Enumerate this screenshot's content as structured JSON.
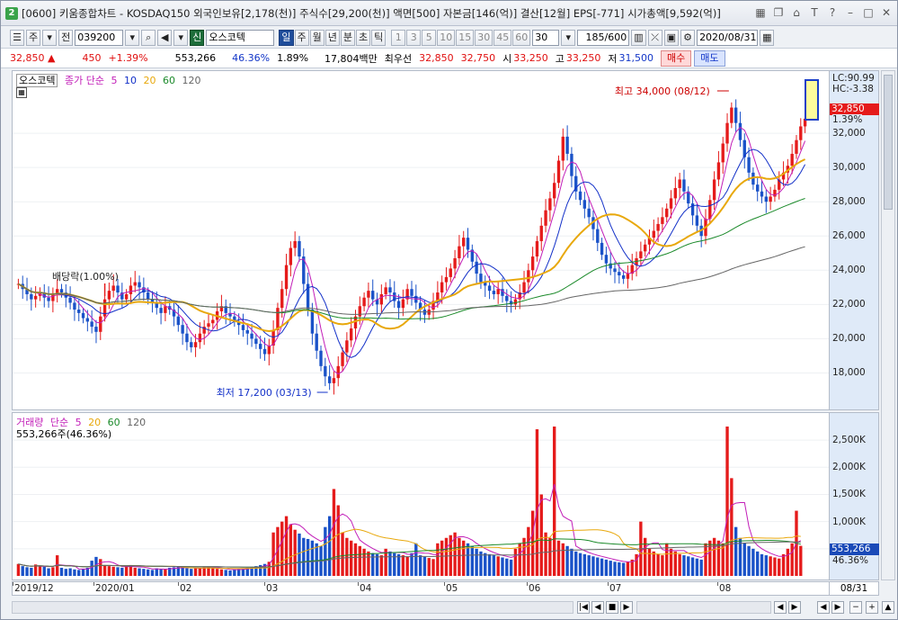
{
  "window": {
    "app_badge": "2",
    "title": "[0600] 키움종합차트 - KOSDAQ150 외국인보유[2,178(천)] 주식수[29,200(천)] 액면[500] 자본금[146(억)] 결산[12월] EPS[-771] 시가총액[9,592(억)]",
    "icons": [
      "grid-icon",
      "copy-icon",
      "lock-icon",
      "font-icon",
      "help-icon",
      "minimize-icon",
      "restore-icon",
      "close-icon"
    ]
  },
  "toolbar": {
    "market": "주",
    "prev": "전",
    "code": "039200",
    "sin": "신",
    "stock_name": "오스코텍",
    "periods": [
      "일",
      "주",
      "월",
      "년",
      "분",
      "초",
      "틱"
    ],
    "active_period": "일",
    "intervals": [
      "1",
      "3",
      "5",
      "10",
      "15",
      "30",
      "45",
      "60"
    ],
    "interval_select": "30",
    "count": "185/600",
    "date": "2020/08/31"
  },
  "quote": {
    "price": "32,850",
    "arrow": "▲",
    "change": "450",
    "change_pct": "+1.39%",
    "volume": "553,266",
    "volume_pct": "46.36%",
    "turnover": "1.89%",
    "amount": "17,804백만",
    "priority_label": "최우선",
    "ask": "32,850",
    "bid": "32,750",
    "open_label": "시",
    "open": "33,250",
    "high_label": "고",
    "high": "33,250",
    "low_label": "저",
    "low": "31,500",
    "buy_label": "매수",
    "sell_label": "매도"
  },
  "price_panel": {
    "legend_name": "오스코텍",
    "legend_ma": "종가 단순",
    "ma_periods": [
      "5",
      "10",
      "20",
      "60",
      "120"
    ],
    "ma_colors": [
      "#c21eb8",
      "#1230c8",
      "#e8a80c",
      "#1b8a2a",
      "#666666"
    ],
    "axis_labels": [
      "32,000",
      "30,000",
      "28,000",
      "26,000",
      "24,000",
      "22,000",
      "20,000",
      "18,000"
    ],
    "lc": "LC:90.99",
    "hc": "HC:-3.38",
    "current_price_tag": "32,850",
    "current_pct_tag": "1.39%",
    "max_annotation": "최고 34,000 (08/12)",
    "min_annotation": "최저 17,200 (03/13)",
    "dividend_annotation": "배당락(1.00%)"
  },
  "volume_panel": {
    "legend_name": "거래량",
    "legend_ma": "단순",
    "ma_periods": [
      "5",
      "20",
      "60",
      "120"
    ],
    "sub_legend": "553,266주(46.36%)",
    "axis_labels": [
      "2,500K",
      "2,000K",
      "1,500K",
      "1,000K",
      "500K"
    ],
    "current_volume_tag": "553,266",
    "current_pct_tag": "46.36%"
  },
  "x_axis": {
    "labels": [
      "2019/12",
      "2020/01",
      "02",
      "03",
      "04",
      "05",
      "06",
      "07",
      "08"
    ],
    "right_label": "08/31"
  },
  "chart_data": {
    "type": "candlestick",
    "x_range": [
      "2019/12",
      "2020/08/31"
    ],
    "ylim": [
      16500,
      35000
    ],
    "volume_ylim": [
      0,
      2800000
    ],
    "close": [
      23200,
      22900,
      22600,
      22300,
      22500,
      22700,
      22400,
      22200,
      22600,
      22900,
      22700,
      22400,
      22100,
      21700,
      21500,
      21200,
      21000,
      20700,
      20400,
      21300,
      22300,
      22800,
      23100,
      22700,
      22300,
      22600,
      23100,
      23300,
      23000,
      22700,
      22300,
      22100,
      21800,
      21500,
      21900,
      21700,
      21300,
      20800,
      20300,
      19800,
      19500,
      19800,
      20300,
      20700,
      20900,
      21100,
      21600,
      21900,
      21500,
      21300,
      21000,
      20800,
      20500,
      20300,
      20000,
      19700,
      19400,
      19100,
      19600,
      20500,
      21800,
      22900,
      24300,
      25300,
      25700,
      24800,
      23200,
      21700,
      20300,
      19300,
      18400,
      17800,
      17400,
      17700,
      18400,
      19200,
      19900,
      20600,
      21300,
      21900,
      22400,
      22800,
      22300,
      22000,
      22600,
      23000,
      22700,
      22200,
      21800,
      22300,
      22900,
      22500,
      22100,
      21700,
      21400,
      21700,
      22200,
      22700,
      23300,
      23600,
      24100,
      24700,
      25400,
      25900,
      25200,
      24500,
      23800,
      23300,
      23100,
      22800,
      22600,
      22900,
      22500,
      22200,
      22000,
      22300,
      22700,
      23300,
      24000,
      24800,
      25700,
      26600,
      27500,
      28200,
      29100,
      30400,
      31800,
      30800,
      29500,
      28600,
      28100,
      27600,
      27100,
      26400,
      25600,
      24900,
      24400,
      24100,
      23900,
      23700,
      23500,
      23800,
      24300,
      24700,
      25100,
      25500,
      25900,
      26300,
      26700,
      27100,
      27600,
      28200,
      28800,
      29300,
      28600,
      27900,
      27200,
      26600,
      26000,
      27000,
      28100,
      29300,
      30300,
      31400,
      32600,
      33500,
      32600,
      31600,
      30600,
      29700,
      29000,
      28600,
      28300,
      28000,
      28300,
      28700,
      29300,
      29700,
      30100,
      30800,
      31600,
      32400,
      32850
    ],
    "volume": [
      220000,
      180000,
      160000,
      150000,
      210000,
      190000,
      170000,
      140000,
      160000,
      380000,
      150000,
      130000,
      140000,
      120000,
      110000,
      130000,
      150000,
      280000,
      350000,
      310000,
      200000,
      180000,
      170000,
      160000,
      150000,
      190000,
      200000,
      150000,
      140000,
      130000,
      120000,
      110000,
      140000,
      130000,
      120000,
      150000,
      160000,
      170000,
      150000,
      140000,
      130000,
      140000,
      150000,
      160000,
      170000,
      140000,
      130000,
      120000,
      110000,
      100000,
      120000,
      130000,
      140000,
      150000,
      160000,
      180000,
      200000,
      220000,
      260000,
      800000,
      900000,
      1000000,
      1100000,
      950000,
      850000,
      780000,
      700000,
      680000,
      650000,
      600000,
      550000,
      900000,
      1100000,
      1600000,
      1300000,
      800000,
      700000,
      650000,
      600000,
      550000,
      500000,
      450000,
      420000,
      400000,
      380000,
      500000,
      450000,
      420000,
      400000,
      380000,
      350000,
      420000,
      600000,
      380000,
      350000,
      330000,
      310000,
      600000,
      650000,
      700000,
      750000,
      800000,
      700000,
      650000,
      600000,
      550000,
      500000,
      450000,
      420000,
      400000,
      380000,
      360000,
      340000,
      320000,
      300000,
      500000,
      600000,
      700000,
      900000,
      1200000,
      2700000,
      1500000,
      800000,
      700000,
      2750000,
      650000,
      600000,
      550000,
      500000,
      450000,
      420000,
      400000,
      380000,
      360000,
      340000,
      320000,
      300000,
      280000,
      260000,
      250000,
      240000,
      260000,
      300000,
      400000,
      1000000,
      700000,
      500000,
      450000,
      400000,
      380000,
      600000,
      500000,
      450000,
      400000,
      380000,
      360000,
      340000,
      320000,
      300000,
      600000,
      650000,
      700000,
      650000,
      600000,
      2750000,
      1800000,
      900000,
      700000,
      600000,
      550000,
      500000,
      450000,
      400000,
      380000,
      360000,
      340000,
      320000,
      400000,
      500000,
      600000,
      1200000,
      553266
    ]
  }
}
